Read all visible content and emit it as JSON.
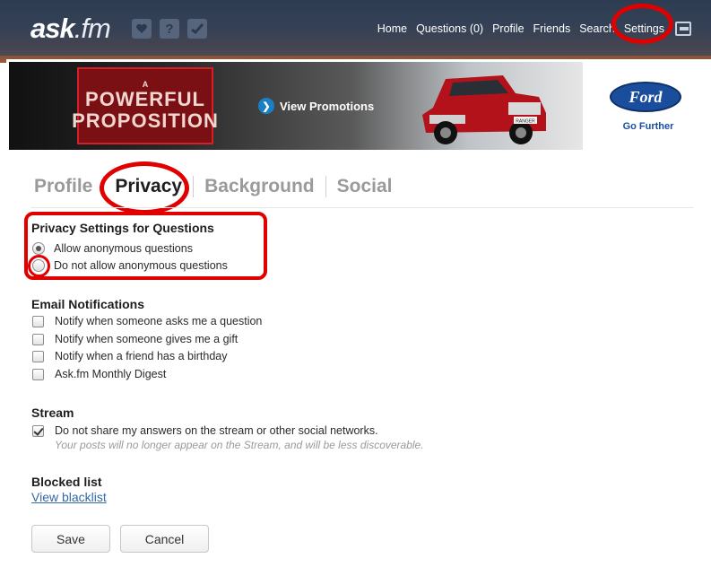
{
  "header": {
    "logo": {
      "main": "ask",
      "suffix": ".fm"
    },
    "icons": [
      "heart-icon",
      "help-icon",
      "check-icon"
    ],
    "nav": [
      {
        "label": "Home"
      },
      {
        "label": "Questions (0)"
      },
      {
        "label": "Profile"
      },
      {
        "label": "Friends"
      },
      {
        "label": "Search"
      },
      {
        "label": "Settings"
      }
    ],
    "logout_icon": "exit-icon"
  },
  "banner": {
    "headline_small": "A",
    "headline_line1": "POWERFUL",
    "headline_line2": "PROPOSITION",
    "cta": "View Promotions",
    "brand": "Ford",
    "tagline": "Go Further",
    "truck_plate": "RANGER"
  },
  "settings": {
    "tabs": [
      {
        "label": "Profile"
      },
      {
        "label": "Privacy"
      },
      {
        "label": "Background"
      },
      {
        "label": "Social"
      }
    ],
    "active_tab": "Privacy",
    "privacy": {
      "title": "Privacy Settings for Questions",
      "options": [
        {
          "label": "Allow anonymous questions",
          "selected": true
        },
        {
          "label": "Do not allow anonymous questions",
          "selected": false
        }
      ]
    },
    "email": {
      "title": "Email Notifications",
      "options": [
        {
          "label": "Notify when someone asks me a question",
          "checked": false
        },
        {
          "label": "Notify when someone gives me a gift",
          "checked": false
        },
        {
          "label": "Notify when a friend has a birthday",
          "checked": false
        },
        {
          "label": "Ask.fm Monthly Digest",
          "checked": false
        }
      ]
    },
    "stream": {
      "title": "Stream",
      "option": {
        "label": "Do not share my answers on the stream or other social networks.",
        "checked": true
      },
      "hint": "Your posts will no longer appear on the Stream, and will be less discoverable."
    },
    "blocked": {
      "title": "Blocked list",
      "link": "View blacklist"
    },
    "buttons": {
      "save": "Save",
      "cancel": "Cancel"
    }
  },
  "colors": {
    "annotation": "#e00000",
    "link": "#3369a8",
    "topbar": "#3b4b60",
    "ford_blue": "#1a4e9c"
  }
}
